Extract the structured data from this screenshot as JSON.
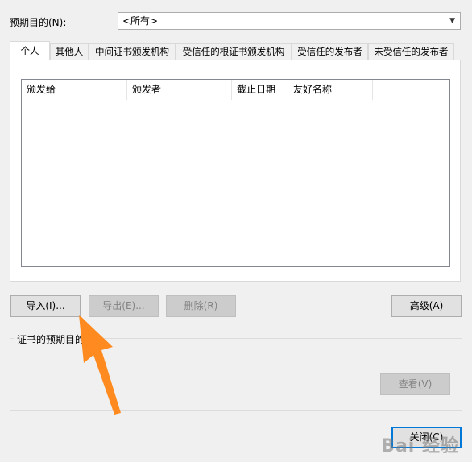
{
  "purpose": {
    "label": "预期目的(N):",
    "selected": "<所有>"
  },
  "tabs": [
    {
      "label": "个人",
      "active": true
    },
    {
      "label": "其他人"
    },
    {
      "label": "中间证书颁发机构"
    },
    {
      "label": "受信任的根证书颁发机构"
    },
    {
      "label": "受信任的发布者"
    },
    {
      "label": "未受信任的发布者"
    }
  ],
  "columns": [
    "颁发给",
    "颁发者",
    "截止日期",
    "友好名称"
  ],
  "buttons": {
    "import": "导入(I)...",
    "export": "导出(E)...",
    "remove": "删除(R)",
    "advanced": "高级(A)",
    "view": "查看(V)",
    "close": "关闭(C)"
  },
  "group": {
    "title": "证书的预期目的"
  },
  "annotation": {
    "arrow_color": "#ff8a1f"
  },
  "watermark": "Bai 经验"
}
